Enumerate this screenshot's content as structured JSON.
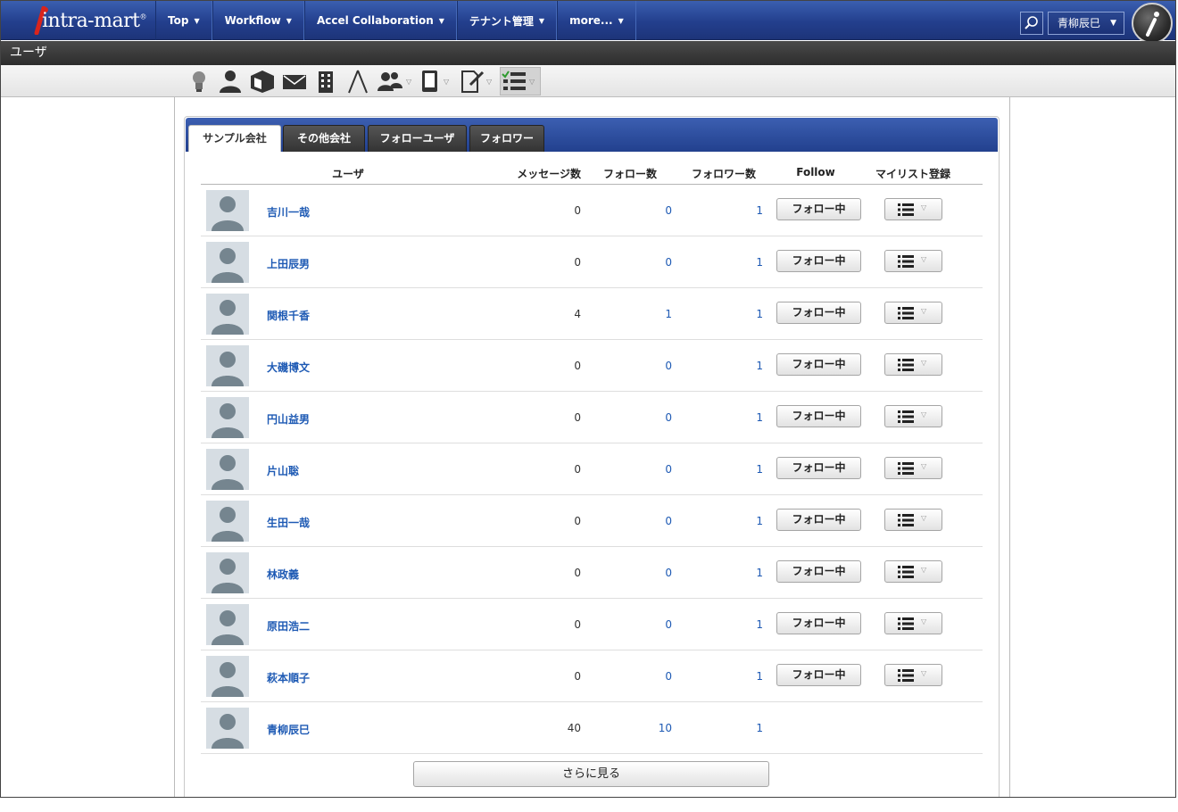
{
  "header": {
    "logo_text": "intra-mart",
    "nav": [
      {
        "label": "Top"
      },
      {
        "label": "Workflow"
      },
      {
        "label": "Accel Collaboration"
      },
      {
        "label": "テナント管理"
      },
      {
        "label": "more..."
      }
    ],
    "user_name": "青柳辰巳"
  },
  "page_title": "ユーザ",
  "toolbar_icons": [
    "lightbulb-icon",
    "person-icon",
    "box-icon",
    "envelope-icon",
    "building-icon",
    "compass-icon",
    "group-icon",
    "device-icon",
    "document-edit-icon",
    "checklist-icon"
  ],
  "tabs": [
    {
      "label": "サンプル会社",
      "active": true
    },
    {
      "label": "その他会社",
      "active": false
    },
    {
      "label": "フォローユーザ",
      "active": false
    },
    {
      "label": "フォロワー",
      "active": false
    }
  ],
  "table": {
    "headers": {
      "user": "ユーザ",
      "messages": "メッセージ数",
      "follows": "フォロー数",
      "followers": "フォロワー数",
      "follow": "Follow",
      "mylist": "マイリスト登録"
    },
    "follow_label": "フォロー中",
    "rows": [
      {
        "name": "吉川一哉",
        "messages": "0",
        "follows": "0",
        "followers": "1",
        "has_actions": true
      },
      {
        "name": "上田辰男",
        "messages": "0",
        "follows": "0",
        "followers": "1",
        "has_actions": true
      },
      {
        "name": "関根千香",
        "messages": "4",
        "follows": "1",
        "followers": "1",
        "has_actions": true
      },
      {
        "name": "大磯博文",
        "messages": "0",
        "follows": "0",
        "followers": "1",
        "has_actions": true
      },
      {
        "name": "円山益男",
        "messages": "0",
        "follows": "0",
        "followers": "1",
        "has_actions": true
      },
      {
        "name": "片山聡",
        "messages": "0",
        "follows": "0",
        "followers": "1",
        "has_actions": true
      },
      {
        "name": "生田一哉",
        "messages": "0",
        "follows": "0",
        "followers": "1",
        "has_actions": true
      },
      {
        "name": "林政義",
        "messages": "0",
        "follows": "0",
        "followers": "1",
        "has_actions": true
      },
      {
        "name": "原田浩二",
        "messages": "0",
        "follows": "0",
        "followers": "1",
        "has_actions": true
      },
      {
        "name": "萩本順子",
        "messages": "0",
        "follows": "0",
        "followers": "1",
        "has_actions": true
      },
      {
        "name": "青柳辰巳",
        "messages": "40",
        "follows": "10",
        "followers": "1",
        "has_actions": false
      }
    ]
  },
  "more_label": "さらに見る"
}
